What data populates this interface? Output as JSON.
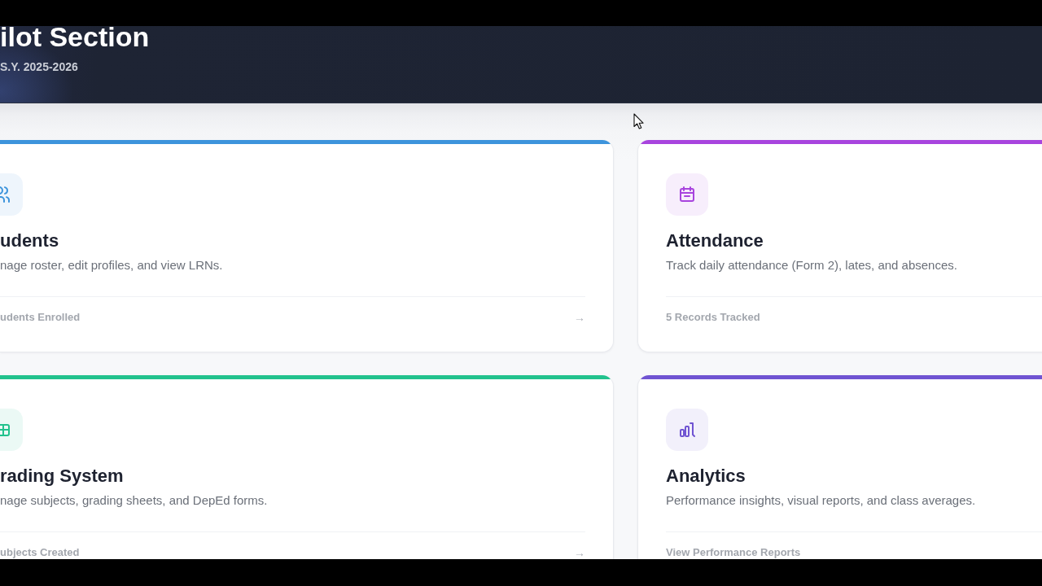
{
  "header": {
    "title": "ilot Section",
    "subtitle": "S.Y. 2025-2026"
  },
  "cards": [
    {
      "title": "udents",
      "description": "nage roster, edit profiles, and view LRNs.",
      "footer": "udents Enrolled",
      "arrow": "→",
      "color": "#3d94dc"
    },
    {
      "title": "Attendance",
      "description": "Track daily attendance (Form 2), lates, and absences.",
      "footer": "5 Records Tracked",
      "color": "#a844de"
    },
    {
      "title": "rading System",
      "description": "nage subjects, grading sheets, and DepEd forms.",
      "footer": "ubjects Created",
      "arrow": "→",
      "color": "#22c28d"
    },
    {
      "title": "Analytics",
      "description": "Performance insights, visual reports, and class averages.",
      "footer": "View Performance Reports",
      "color": "#7054d2"
    }
  ]
}
